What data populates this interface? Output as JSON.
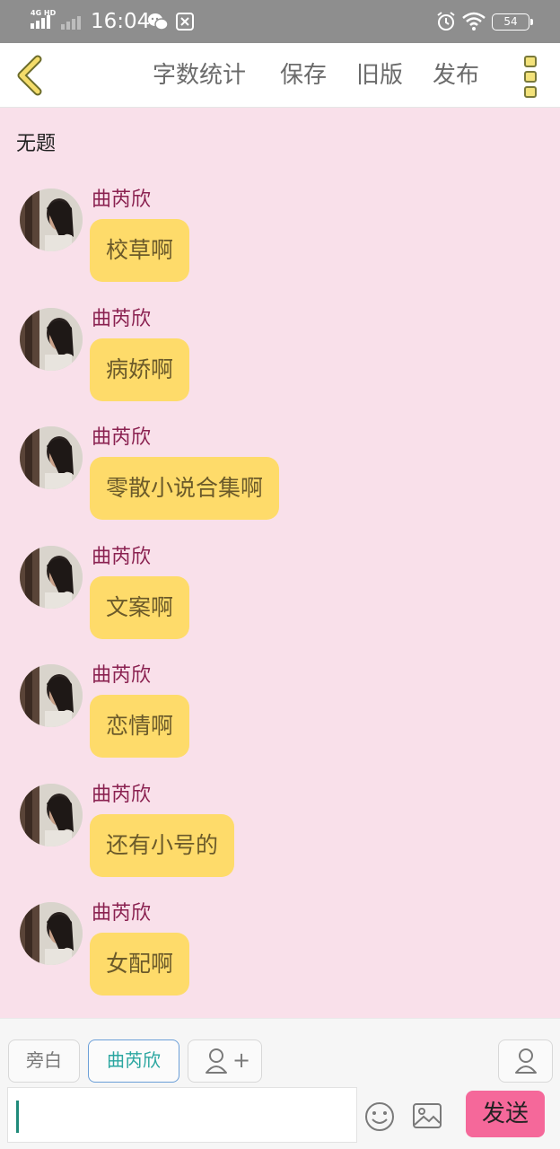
{
  "status_bar": {
    "network": "4G HD",
    "time": "16:04",
    "battery": "54",
    "icons": [
      "signal-icon",
      "signal-weak-icon",
      "wechat-icon",
      "payment-icon",
      "alarm-icon",
      "wifi-icon",
      "battery-icon"
    ]
  },
  "toolbar": {
    "back_icon": "chevron-left-icon",
    "word_count_label": "字数统计",
    "save_label": "保存",
    "old_version_label": "旧版",
    "publish_label": "发布",
    "more_icon": "more-vertical-icon"
  },
  "document": {
    "title": "无题"
  },
  "messages": [
    {
      "sender": "曲芮欣",
      "text": "校草啊"
    },
    {
      "sender": "曲芮欣",
      "text": "病娇啊"
    },
    {
      "sender": "曲芮欣",
      "text": "零散小说合集啊"
    },
    {
      "sender": "曲芮欣",
      "text": "文案啊"
    },
    {
      "sender": "曲芮欣",
      "text": "恋情啊"
    },
    {
      "sender": "曲芮欣",
      "text": "还有小号的"
    },
    {
      "sender": "曲芮欣",
      "text": "女配啊"
    }
  ],
  "composer": {
    "narration_label": "旁白",
    "character_label": "曲芮欣",
    "add_role_symbol": "+",
    "input_value": "",
    "send_label": "发送",
    "icons": [
      "add-user-icon",
      "user-icon",
      "emoji-icon",
      "image-icon"
    ]
  },
  "colors": {
    "background": "#f9e0ea",
    "bubble": "#fedb6a",
    "sender_name": "#8a2150",
    "send_button": "#f5689a",
    "selected_chip_border": "#6b9fd8"
  }
}
